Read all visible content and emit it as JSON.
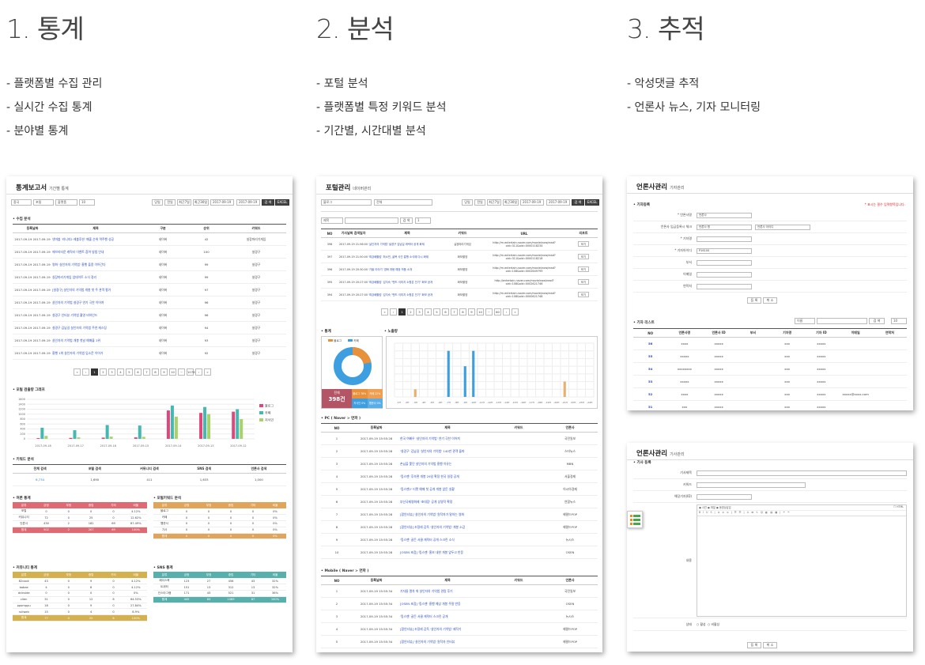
{
  "columns": [
    {
      "title": "1. 통계",
      "bullets": [
        "- 플랫폼별 수집 관리",
        "- 실시간 수집 통계",
        "- 분야별 통계"
      ]
    },
    {
      "title": "2. 분석",
      "bullets": [
        "- 포털 분석",
        "- 플랫폼별 특정 키워드 분석",
        "- 기간별, 시간대별 분석"
      ]
    },
    {
      "title": "3. 추적",
      "bullets": [
        "- 악성댓글 추적",
        "- 언론사 뉴스, 기자 모니터링"
      ]
    }
  ],
  "stats": {
    "title": "통계보고서",
    "subtitle": "기간별 통계",
    "filters": [
      "중국",
      "포털",
      "플랫폼",
      "10"
    ],
    "range_buttons": [
      "당일",
      "전일",
      "최근7일",
      "최근30일"
    ],
    "date_from": "2017-09-19",
    "date_to": "2017-09-19",
    "search": "검 색",
    "excel": "EXCEL",
    "list_section": "수집 분석",
    "list_headers": [
      "등록날짜",
      "제목",
      "구분",
      "순위",
      "키워드"
    ],
    "list_rows": [
      [
        "2017-09-19 2017-09-19",
        "넷마블 '리니지2 레볼루션' 매출 순위 역주행 성공",
        "네이버",
        "42",
        "실장마리기게임"
      ],
      [
        "2017-09-19 2017-09-19",
        "에브리타운 캐릭터 이벤트 참여 방법 안내",
        "네이버",
        "100",
        "설경구"
      ],
      [
        "2017-09-19 2017-09-19",
        "영화 '살인자의 기억법' 흥행 돌풍 이어간다",
        "네이버",
        "99",
        "설경구"
      ],
      [
        "2017-09-19 2017-09-19",
        "실장마리기게임 업데이트 소식 정리",
        "네이버",
        "99",
        "설경구"
      ],
      [
        "2017-09-19 2017-09-19",
        "[설경구] 살인자의 기억법 개봉 첫 주 관객 평가",
        "네이버",
        "97",
        "설경구"
      ],
      [
        "2017-09-19 2017-09-19",
        "살인자의 기억법 설경구 연기 극찬 이어져",
        "네이버",
        "96",
        "설경구"
      ],
      [
        "2017-09-19 2017-09-19",
        "설경구 인터뷰 기억법 촬영 비하인드",
        "네이버",
        "96",
        "설경구"
      ],
      [
        "2017-09-19 2017-09-19",
        "설경구 김남길 살인자의 기억법 주연 캐스팅",
        "네이버",
        "94",
        "설경구"
      ],
      [
        "2017-09-19 2017-09-19",
        "살인자의 기억법 개봉 첫날 예매율 1위",
        "네이버",
        "93",
        "설경구"
      ],
      [
        "2017-09-19 2017-09-19",
        "흥행 1위 살인자의 기억법 입소문 이어가",
        "네이버",
        "92",
        "설경구"
      ]
    ],
    "pages": [
      "«",
      "‹",
      "1",
      "2",
      "3",
      "4",
      "5",
      "6",
      "7",
      "8",
      "9",
      "10",
      "···",
      "1076",
      "›",
      "»"
    ],
    "graph_section": "포털 검출량 그래프",
    "graph_dates": [
      "2017-09-18",
      "2017-09-17",
      "2017-09-16",
      "2017-09-15",
      "2017-09-14",
      "2017-09-13",
      "2017-09-12"
    ],
    "graph_legend": [
      "블로그",
      "카페",
      "지식인"
    ],
    "graph_colors": [
      "#e0457b",
      "#45b8b0",
      "#a8d26a"
    ],
    "keyword_section": "키워드 분석",
    "keyword_headers": [
      "전체 검색",
      "포털 검색",
      "커뮤니티 검색",
      "SNS 검색",
      "언론사 검색"
    ],
    "keyword_values": [
      "6,734",
      "1,690",
      "411",
      "1,633",
      "1,000"
    ],
    "s1_title": "여론 통계",
    "s2_title": "포털키워드 분석",
    "s3_title": "커뮤니티 통계",
    "s4_title": "SNS 통계",
    "mini_headers": [
      "분류",
      "긍정",
      "부정",
      "중립",
      "기타",
      "비율"
    ],
    "s1_rows": [
      [
        "포털",
        "0",
        "0",
        "0",
        "0",
        "4.12%"
      ],
      [
        "커뮤니티",
        "72",
        "0",
        "25",
        "0",
        "12.62%"
      ],
      [
        "언론사",
        "430",
        "2",
        "182",
        "69",
        "87.49%"
      ],
      [
        "합계",
        "502",
        "2",
        "207",
        "69",
        "100%"
      ]
    ],
    "s2_rows": [
      [
        "블로그",
        "0",
        "0",
        "0",
        "0",
        "0%"
      ],
      [
        "카페",
        "0",
        "0",
        "0",
        "0",
        "0%"
      ],
      [
        "웹문서",
        "0",
        "0",
        "0",
        "0",
        "0%"
      ],
      [
        "기사",
        "0",
        "0",
        "0",
        "0",
        "0%"
      ],
      [
        "합계",
        "0",
        "0",
        "0",
        "0",
        "0%"
      ]
    ],
    "s3_rows": [
      [
        "82cook",
        "43",
        "0",
        "9",
        "0",
        "4.12%"
      ],
      [
        "bobae",
        "4",
        "0",
        "8",
        "0",
        "4.12%"
      ],
      [
        "dcinside",
        "0",
        "0",
        "0",
        "0",
        "0%"
      ],
      [
        "clien",
        "31",
        "0",
        "12",
        "6",
        "64.53%"
      ],
      [
        "ppomppu",
        "18",
        "0",
        "9",
        "0",
        "27.84%"
      ],
      [
        "ruliweb",
        "15",
        "0",
        "4",
        "0",
        "8.9%"
      ],
      [
        "합계",
        "77",
        "0",
        "25",
        "6",
        "100%"
      ]
    ],
    "s4_rows": [
      [
        "페이스북",
        "123",
        "27",
        "456",
        "43",
        "32%"
      ],
      [
        "트위터",
        "151",
        "13",
        "312",
        "13",
        "32%"
      ],
      [
        "인스타그램",
        "171",
        "43",
        "521",
        "31",
        "36%"
      ],
      [
        "합계",
        "445",
        "83",
        "1089",
        "87",
        "100%"
      ]
    ]
  },
  "portal": {
    "title": "포털관리",
    "subtitle": "네이버관리",
    "filters": [
      "블로그",
      "전체"
    ],
    "range_buttons": [
      "당일",
      "전일",
      "최근7일",
      "최근30일"
    ],
    "date_from": "2017-09-19",
    "date_to": "2017-09-19",
    "search": "검 색",
    "excel": "EXCEL",
    "kw_select": "제목",
    "kw_btn": "검 색",
    "kw_count": "1",
    "list_headers": [
      "NO",
      "기사날짜 검색일자",
      "제목",
      "키워드",
      "URL",
      "리포트"
    ],
    "list_rows": [
      [
        "398",
        "2017-09-19 21:56:00",
        "'살인자의 기억법' 설경구 김남길 캐릭터 공개 화제",
        "실장마리기게임",
        "http://m.entertain.naver.com/movie/now/read?oid=311&aid=0000118234",
        "보기"
      ],
      [
        "397",
        "2017-09-19 21:50:00",
        "'최강배틀킹' 최소민, 굴욕 사진 흥행 소식에 다시 화제",
        "화보촬영",
        "http://m.entertain.naver.com/movie/now/read?oid=311&aid=0000118218",
        "보기"
      ],
      [
        "396",
        "2017-09-19 20:30:00",
        "'가을 이야기' 영화 개봉 예정 작품 소개",
        "화보촬영",
        "http://m.entertain.naver.com/movie/now/read?oid=108&aid=0002649799",
        "보기"
      ],
      [
        "395",
        "2017-09-19 20:27:00",
        "'최강배틀킹' 김지숙 \"밴드 이미지 소원은 인기\" 화보 공개",
        "화보촬영",
        "http://entertain.naver.com/movie/now/read?oid=108&aid=0002621746",
        "보기"
      ],
      [
        "394",
        "2017-09-19 20:27:00",
        "'최강배틀킹' 김지숙 \"밴드 이미지 소원은 인기\" 화보 공개",
        "화보촬영",
        "http://m.entertain.naver.com/movie/now/read?oid=108&aid=0000621748",
        "보기"
      ]
    ],
    "pages": [
      "«",
      "‹",
      "1",
      "2",
      "3",
      "4",
      "5",
      "6",
      "7",
      "8",
      "9",
      "10",
      "···",
      "80",
      "›",
      "»"
    ],
    "stat_section": "통계",
    "chart_section": "노출량",
    "donut_legend": [
      "블로그",
      "카페"
    ],
    "total_label": "전체",
    "total_value": "398건",
    "sub_labels": [
      "블로그 78%",
      "카페 22%",
      "지식인 0%",
      "웹문서 0%"
    ],
    "bar_labels": [
      "-1H",
      "-2H",
      "-3H",
      "-4H",
      "-5H",
      "-6H",
      "-7H",
      "-8H",
      "-9H",
      "-10H",
      "-11H",
      "-12H",
      "-13H",
      "-14H",
      "-15H",
      "-16H",
      "-17H",
      "-18H",
      "-19H",
      "-20H",
      "-21H",
      "-22H",
      "-23H",
      "-24H"
    ],
    "bar_values": [
      0,
      0,
      10,
      0,
      0,
      0,
      60,
      0,
      40,
      60,
      0,
      0,
      0,
      0,
      0,
      0,
      0,
      0,
      0,
      0,
      20,
      0,
      0,
      0
    ],
    "bar_series2": [
      0,
      0,
      0,
      0,
      0,
      0,
      0,
      0,
      0,
      0,
      0,
      0,
      0,
      0,
      0,
      0,
      0,
      0,
      0,
      0,
      0,
      0,
      0,
      0
    ],
    "pc_section": "PC ( Naver > 연파 )",
    "mo_section": "Mobile ( Naver > 연파 )",
    "news_headers": [
      "NO",
      "등록날짜",
      "제목",
      "키워드",
      "언론사"
    ],
    "pc_rows": [
      [
        "1",
        "2017-09-19 15:55:28",
        "한국 여배우 '살인자의 기억법' 연기 극찬 이어져",
        "",
        "국민일보"
      ],
      [
        "2",
        "2017-09-19 15:55:28",
        "'설경구' 김남길 '살인자의 기억법' 140만 관객 돌파",
        "",
        "스타뉴스"
      ],
      [
        "3",
        "2017-09-19 15:55:28",
        "손님을 쫓던 살인자의 기억법 흥행 이유는",
        "",
        "MBN"
      ],
      [
        "4",
        "2017-09-19 15:55:28",
        "'킹스맨' 후속편 개봉 29일 확정 한국 일정 공개",
        "",
        "서울경제"
      ],
      [
        "5",
        "2017-09-19 15:55:28",
        "'킹스맨2' 티켓 예매 첫 공개 개봉 앞둔 실황",
        "",
        "아시아경제"
      ],
      [
        "6",
        "2017-09-19 15:55:28",
        "부산국제영화제 '초대장' 공개 상영작 확정",
        "",
        "연합뉴스"
      ],
      [
        "7",
        "2017-09-19 15:55:28",
        "[팝인터뷰] '살인자의 기억법' 원작자가 말하는 영화",
        "",
        "헤럴드POP"
      ],
      [
        "8",
        "2017-09-19 15:55:28",
        "[팝인터뷰] 조정래 감독 '살인자의 기억법' 개봉 소감",
        "",
        "헤럴드POP"
      ],
      [
        "9",
        "2017-09-19 15:55:28",
        "'킹스맨' 골든 서클 캐릭터 공개 스크린 소식",
        "",
        "뉴시스"
      ],
      [
        "10",
        "2017-09-19 15:55:28",
        "[OSEN 초점] '킹스맨' 홍보 내한 개봉 앞두고 반응",
        "",
        "OSEN"
      ]
    ],
    "mo_rows": [
      [
        "1",
        "2017-09-19 15:55:34",
        "기자들 열차 위 살인자의 기억법 관람 후기",
        "",
        "국민일보"
      ],
      [
        "2",
        "2017-09-19 15:55:34",
        "[OSEN 초점] '킹스맨' 흥행 예상 개봉 주말 반응",
        "",
        "OSEN"
      ],
      [
        "3",
        "2017-09-19 15:55:34",
        "'킹스맨' 골든 서클 캐릭터 스크린 공개",
        "",
        "뉴시스"
      ],
      [
        "4",
        "2017-09-19 15:55:34",
        "[팝인터뷰] 조정래 감독 '살인자의 기억법' 제작기",
        "",
        "헤럴드POP"
      ],
      [
        "5",
        "2017-09-19 15:55:34",
        "[팝인터뷰] '살인자의 기억법' 원작자 인터뷰",
        "",
        "헤럴드POP"
      ]
    ]
  },
  "press": {
    "title": "언론사관리",
    "subtitle": "기자관리",
    "reg_section": "기자등록",
    "req_note": "* 표시는 필수 입력항목입니다.",
    "fields": [
      "* 언론사명",
      "언론사 입금등록시 체크",
      "* 기자명",
      "* 기자아이디",
      "부서",
      "이메일",
      "연락처"
    ],
    "field_values": [
      "언론사",
      "언론사 명",
      "",
      "P16100",
      "",
      "",
      ""
    ],
    "field_values2": [
      "",
      "언론사 아이디",
      "",
      "",
      "",
      "",
      ""
    ],
    "btns": [
      "등 록",
      "취 소"
    ],
    "list_section": "기자 리스트",
    "list_filter": "이름",
    "list_btn": "검 색",
    "list_count": "10",
    "list_headers": [
      "NO",
      "언론사명",
      "언론사 ID",
      "부서",
      "기자명",
      "기자 ID",
      "이메일",
      "연락처"
    ],
    "list_rows": [
      [
        "56",
        "xxxx",
        "xxxxx",
        "",
        "xxx",
        "xxxxx",
        "",
        ""
      ],
      [
        "55",
        "xxxxx",
        "xxxxx",
        "",
        "xxx",
        "xxxxx",
        "",
        ""
      ],
      [
        "54",
        "xxxxxxxx",
        "xxxxx",
        "",
        "xxx",
        "xxxxx",
        "",
        ""
      ],
      [
        "53",
        "xxxxx",
        "xxxxx",
        "",
        "xxx",
        "xxxxx",
        "",
        ""
      ],
      [
        "52",
        "xxxx",
        "xxxxx",
        "",
        "xxx",
        "xxxxx",
        "xxxxx@xxxx.com",
        ""
      ],
      [
        "51",
        "xxx",
        "xxxxx",
        "",
        "xxx",
        "xxxxx",
        "",
        ""
      ]
    ]
  },
  "article": {
    "title": "언론사관리",
    "subtitle": "기사관리",
    "reg_section": "기사 등록",
    "fields": [
      "기사제목",
      "키워드",
      "해당기자(ID)"
    ],
    "content_label": "내용",
    "editor_opts": [
      "사진",
      "파일",
      "동영상삽입"
    ],
    "html_label": "HTML",
    "status_label": "상태",
    "status_opts": [
      "활성",
      "비활성"
    ],
    "btns": [
      "등 록",
      "취 소"
    ]
  }
}
